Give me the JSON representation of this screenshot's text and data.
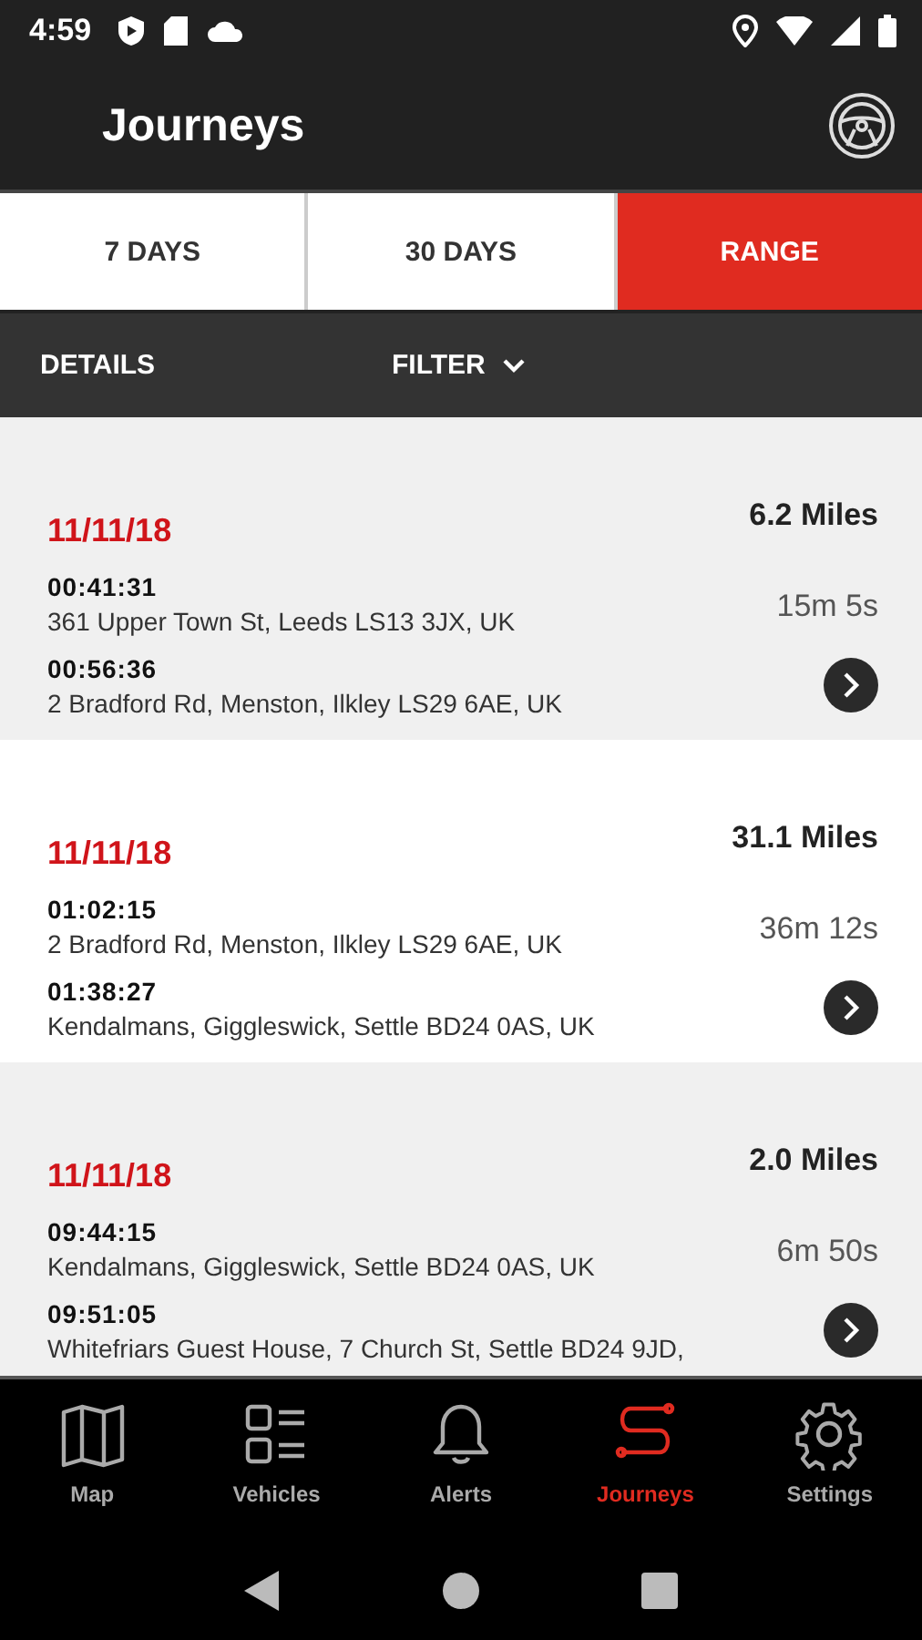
{
  "status_bar": {
    "time": "4:59"
  },
  "header": {
    "title": "Journeys"
  },
  "tabs": [
    {
      "label": "7 DAYS",
      "selected": false
    },
    {
      "label": "30 DAYS",
      "selected": false
    },
    {
      "label": "RANGE",
      "selected": true
    }
  ],
  "toolbar": {
    "details": "DETAILS",
    "filter": "FILTER"
  },
  "journeys": [
    {
      "date": "11/11/18",
      "distance": "6.2 Miles",
      "duration": "15m 5s",
      "start_time": "00:41:31",
      "start_address": "361 Upper Town St, Leeds LS13 3JX, UK",
      "end_time": "00:56:36",
      "end_address": "2 Bradford Rd, Menston, Ilkley LS29 6AE, UK"
    },
    {
      "date": "11/11/18",
      "distance": "31.1 Miles",
      "duration": "36m 12s",
      "start_time": "01:02:15",
      "start_address": "2 Bradford Rd, Menston, Ilkley LS29 6AE, UK",
      "end_time": "01:38:27",
      "end_address": "Kendalmans, Giggleswick, Settle BD24 0AS, UK"
    },
    {
      "date": "11/11/18",
      "distance": "2.0 Miles",
      "duration": "6m 50s",
      "start_time": "09:44:15",
      "start_address": "Kendalmans, Giggleswick, Settle BD24 0AS, UK",
      "end_time": "09:51:05",
      "end_address": "Whitefriars Guest House, 7 Church St, Settle BD24 9JD,"
    }
  ],
  "bottom_nav": [
    {
      "kind": "map",
      "label": "Map",
      "selected": false
    },
    {
      "kind": "vehicles",
      "label": "Vehicles",
      "selected": false
    },
    {
      "kind": "alerts",
      "label": "Alerts",
      "selected": false
    },
    {
      "kind": "journeys",
      "label": "Journeys",
      "selected": true
    },
    {
      "kind": "settings",
      "label": "Settings",
      "selected": false
    }
  ]
}
